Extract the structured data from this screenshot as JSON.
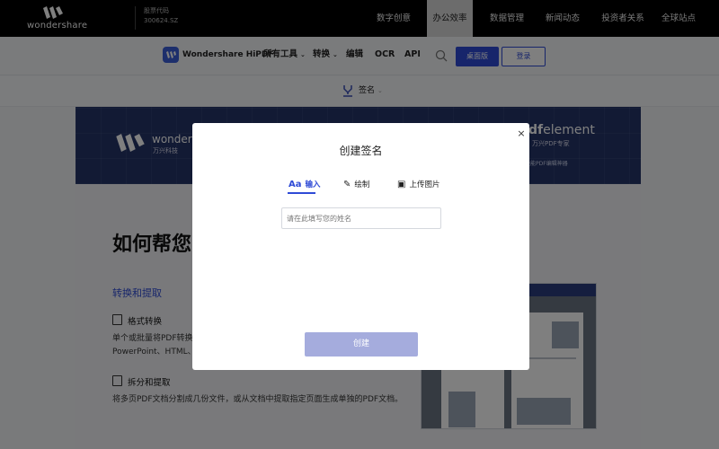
{
  "topbar": {
    "brand": "wondershare",
    "stock_label": "股票代码",
    "stock_code": "300624.SZ",
    "nav": [
      "数字创意",
      "办公效率",
      "数据管理",
      "新闻动态",
      "投资者关系",
      "全球站点"
    ],
    "active_nav": "办公效率"
  },
  "subnav": {
    "product": "Wondershare HiPDF",
    "items": [
      "所有工具",
      "转换",
      "编辑",
      "OCR",
      "API"
    ],
    "desktop_label": "桌面版",
    "login_label": "登录"
  },
  "toolbar": {
    "label": "签名"
  },
  "banner": {
    "brand": "wonders",
    "brand_sub": "万兴科技",
    "pdfelement_bold": "pdf",
    "pdfelement_rest": "element",
    "pdfelement_sub": "万兴PDF专家",
    "pdfelement_tag": "的全能PDF编辑神器"
  },
  "content": {
    "heading": "如何帮您",
    "section_title": "转换和提取",
    "feature1_title": "格式转换",
    "feature1_desc1": "单个或批量将PDF转换",
    "feature1_desc2": "PowerPoint、HTML、",
    "feature2_title": "拆分和提取",
    "feature2_desc": "将多页PDF文档分割成几份文件，或从文档中提取指定页面生成单独的PDF文档。"
  },
  "modal": {
    "title": "创建签名",
    "close": "×",
    "tabs": [
      {
        "icon": "Aa",
        "label": "输入"
      },
      {
        "icon": "✎",
        "label": "绘制"
      },
      {
        "icon": "▣",
        "label": "上传图片"
      }
    ],
    "input_placeholder": "请在此填写您的姓名",
    "input_value": "",
    "create_label": "创建"
  },
  "colors": {
    "accent": "#2f4bd6",
    "banner": "#243468",
    "create_disabled": "#a5acdd"
  }
}
